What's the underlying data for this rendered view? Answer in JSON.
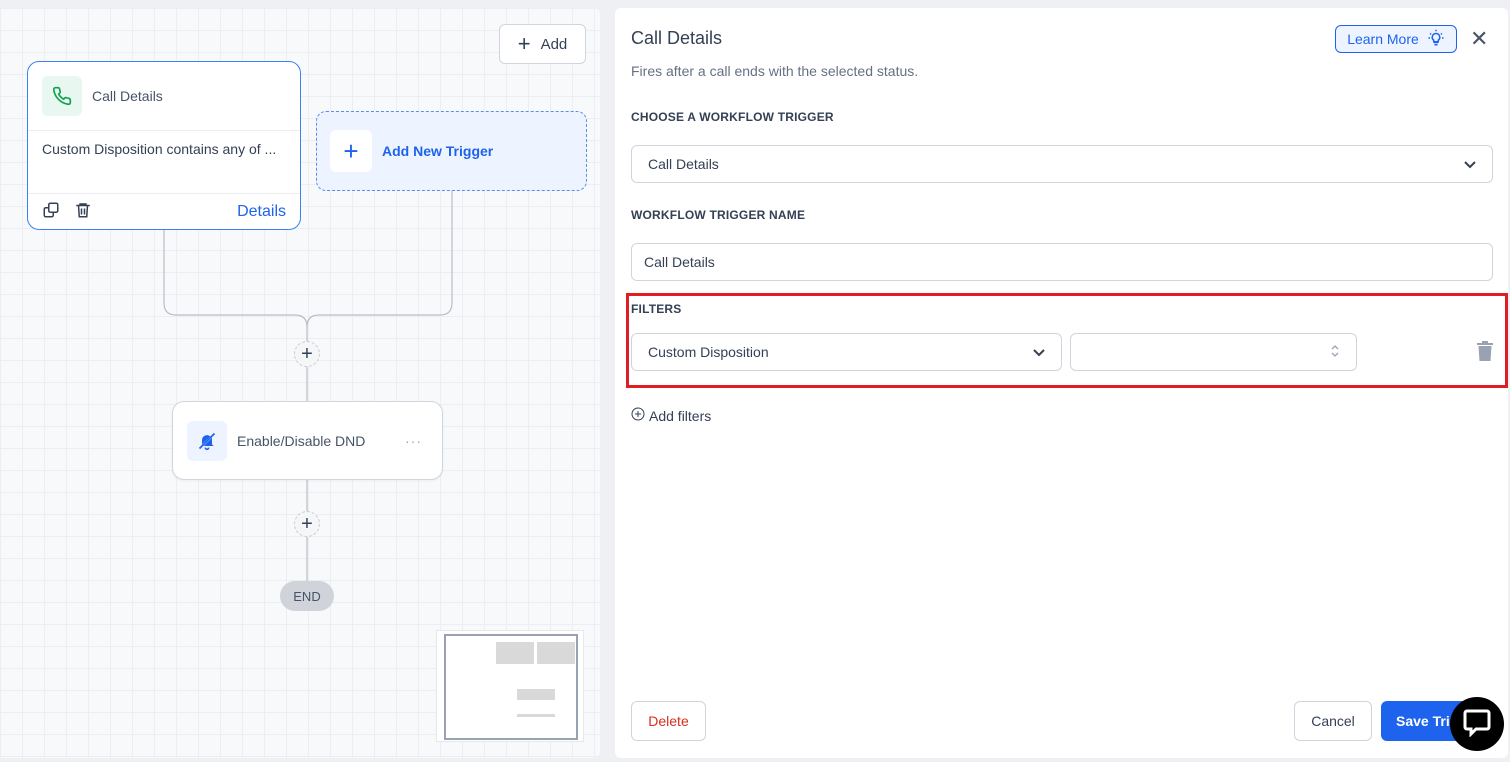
{
  "canvas": {
    "add_button": "Add",
    "trigger_card": {
      "title": "Call Details",
      "description": "Custom Disposition contains any of ...",
      "details_link": "Details"
    },
    "add_trigger": "Add New Trigger",
    "action_node": {
      "title": "Enable/Disable DND",
      "menu": "···"
    },
    "end_label": "END"
  },
  "panel": {
    "title": "Call Details",
    "subtitle": "Fires after a call ends with the selected status.",
    "learn_more": "Learn More",
    "trigger_label": "CHOOSE A WORKFLOW TRIGGER",
    "trigger_value": "Call Details",
    "name_label": "WORKFLOW TRIGGER NAME",
    "name_value": "Call Details",
    "filters_label": "FILTERS",
    "filter_field": "Custom Disposition",
    "filter_operator": "",
    "add_filters": "Add filters",
    "delete": "Delete",
    "cancel": "Cancel",
    "save": "Save Trigger"
  },
  "colors": {
    "accent": "#1d63ed",
    "highlight": "#e11d24",
    "danger": "#d92d20"
  }
}
